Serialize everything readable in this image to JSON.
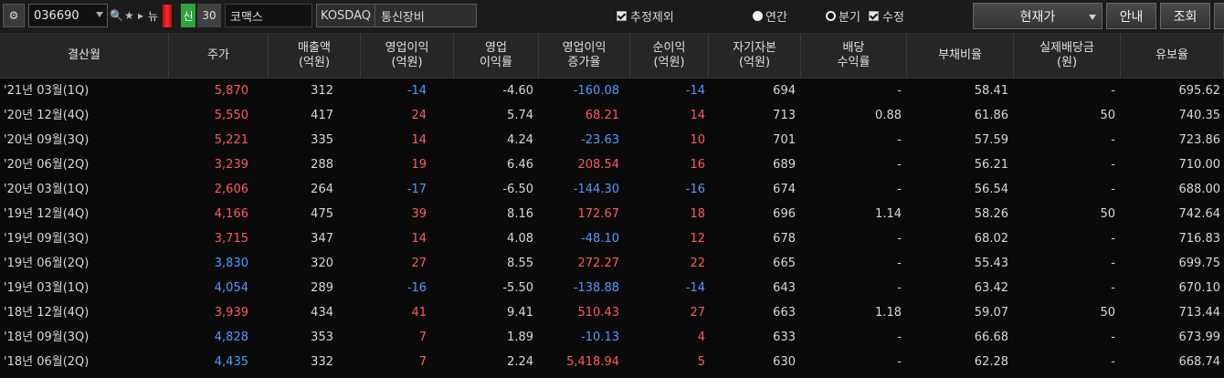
{
  "toolbar": {
    "settings_icon": "settings-icon",
    "stock_code": "036690",
    "search_icon_glyph": "🔍",
    "star_glyph": "★",
    "arrow_glyph": "▸",
    "new_label": "뉴",
    "sin_label": "신",
    "count_30": "30",
    "company_name": "코맥스",
    "market": "KOSDAQ",
    "sector": "통신장비",
    "exclude_estimate_label": "추정제외",
    "annual_label": "연간",
    "quarterly_label": "분기",
    "adjusted_label": "수정",
    "price_select": "현재가",
    "guide_button": "안내",
    "query_button": "조회"
  },
  "table": {
    "headers": [
      "결산월",
      "주가",
      "매출액\n(억원)",
      "영업이익\n(억원)",
      "영업\n이익률",
      "영업이익\n증가율",
      "순이익\n(억원)",
      "자기자본\n(억원)",
      "배당\n수익률",
      "부채비율",
      "실제배당금\n(원)",
      "유보율"
    ],
    "rows": [
      {
        "period": "'21년 03월(1Q)",
        "price": "5,870",
        "sales": "312",
        "op": "-14",
        "margin": "-4.60",
        "growth": "-160.08",
        "net": "-14",
        "equity": "694",
        "div_yield": "-",
        "debt": "58.41",
        "dividend": "-",
        "reserve": "695.62"
      },
      {
        "period": "'20년 12월(4Q)",
        "price": "5,550",
        "sales": "417",
        "op": "24",
        "margin": "5.74",
        "growth": "68.21",
        "net": "14",
        "equity": "713",
        "div_yield": "0.88",
        "debt": "61.86",
        "dividend": "50",
        "reserve": "740.35"
      },
      {
        "period": "'20년 09월(3Q)",
        "price": "5,221",
        "sales": "335",
        "op": "14",
        "margin": "4.24",
        "growth": "-23.63",
        "net": "10",
        "equity": "701",
        "div_yield": "-",
        "debt": "57.59",
        "dividend": "-",
        "reserve": "723.86"
      },
      {
        "period": "'20년 06월(2Q)",
        "price": "3,239",
        "sales": "288",
        "op": "19",
        "margin": "6.46",
        "growth": "208.54",
        "net": "16",
        "equity": "689",
        "div_yield": "-",
        "debt": "56.21",
        "dividend": "-",
        "reserve": "710.00"
      },
      {
        "period": "'20년 03월(1Q)",
        "price": "2,606",
        "sales": "264",
        "op": "-17",
        "margin": "-6.50",
        "growth": "-144.30",
        "net": "-16",
        "equity": "674",
        "div_yield": "-",
        "debt": "56.54",
        "dividend": "-",
        "reserve": "688.00"
      },
      {
        "period": "'19년 12월(4Q)",
        "price": "4,166",
        "sales": "475",
        "op": "39",
        "margin": "8.16",
        "growth": "172.67",
        "net": "18",
        "equity": "696",
        "div_yield": "1.14",
        "debt": "58.26",
        "dividend": "50",
        "reserve": "742.64"
      },
      {
        "period": "'19년 09월(3Q)",
        "price": "3,715",
        "sales": "347",
        "op": "14",
        "margin": "4.08",
        "growth": "-48.10",
        "net": "12",
        "equity": "678",
        "div_yield": "-",
        "debt": "68.02",
        "dividend": "-",
        "reserve": "716.83"
      },
      {
        "period": "'19년 06월(2Q)",
        "price": "3,830",
        "sales": "320",
        "op": "27",
        "margin": "8.55",
        "growth": "272.27",
        "net": "22",
        "equity": "665",
        "div_yield": "-",
        "debt": "55.43",
        "dividend": "-",
        "reserve": "699.75"
      },
      {
        "period": "'19년 03월(1Q)",
        "price": "4,054",
        "sales": "289",
        "op": "-16",
        "margin": "-5.50",
        "growth": "-138.88",
        "net": "-14",
        "equity": "643",
        "div_yield": "-",
        "debt": "63.42",
        "dividend": "-",
        "reserve": "670.10"
      },
      {
        "period": "'18년 12월(4Q)",
        "price": "3,939",
        "sales": "434",
        "op": "41",
        "margin": "9.41",
        "growth": "510.43",
        "net": "27",
        "equity": "663",
        "div_yield": "1.18",
        "debt": "59.07",
        "dividend": "50",
        "reserve": "713.44"
      },
      {
        "period": "'18년 09월(3Q)",
        "price": "4,828",
        "sales": "353",
        "op": "7",
        "margin": "1.89",
        "growth": "-10.13",
        "net": "4",
        "equity": "633",
        "div_yield": "-",
        "debt": "66.68",
        "dividend": "-",
        "reserve": "673.99"
      },
      {
        "period": "'18년 06월(2Q)",
        "price": "4,435",
        "sales": "332",
        "op": "7",
        "margin": "2.24",
        "growth": "5,418.94",
        "net": "5",
        "equity": "630",
        "div_yield": "-",
        "debt": "62.28",
        "dividend": "-",
        "reserve": "668.74"
      }
    ],
    "price_colors": [
      "red",
      "red",
      "red",
      "red",
      "red",
      "red",
      "red",
      "blue",
      "blue",
      "red",
      "blue",
      "blue"
    ]
  },
  "colors": {
    "up": "#ff5a5a",
    "down": "#4f9bff",
    "neutral": "#d8d8d8",
    "header_bg": "#262626",
    "bg": "#0a0a0a"
  }
}
